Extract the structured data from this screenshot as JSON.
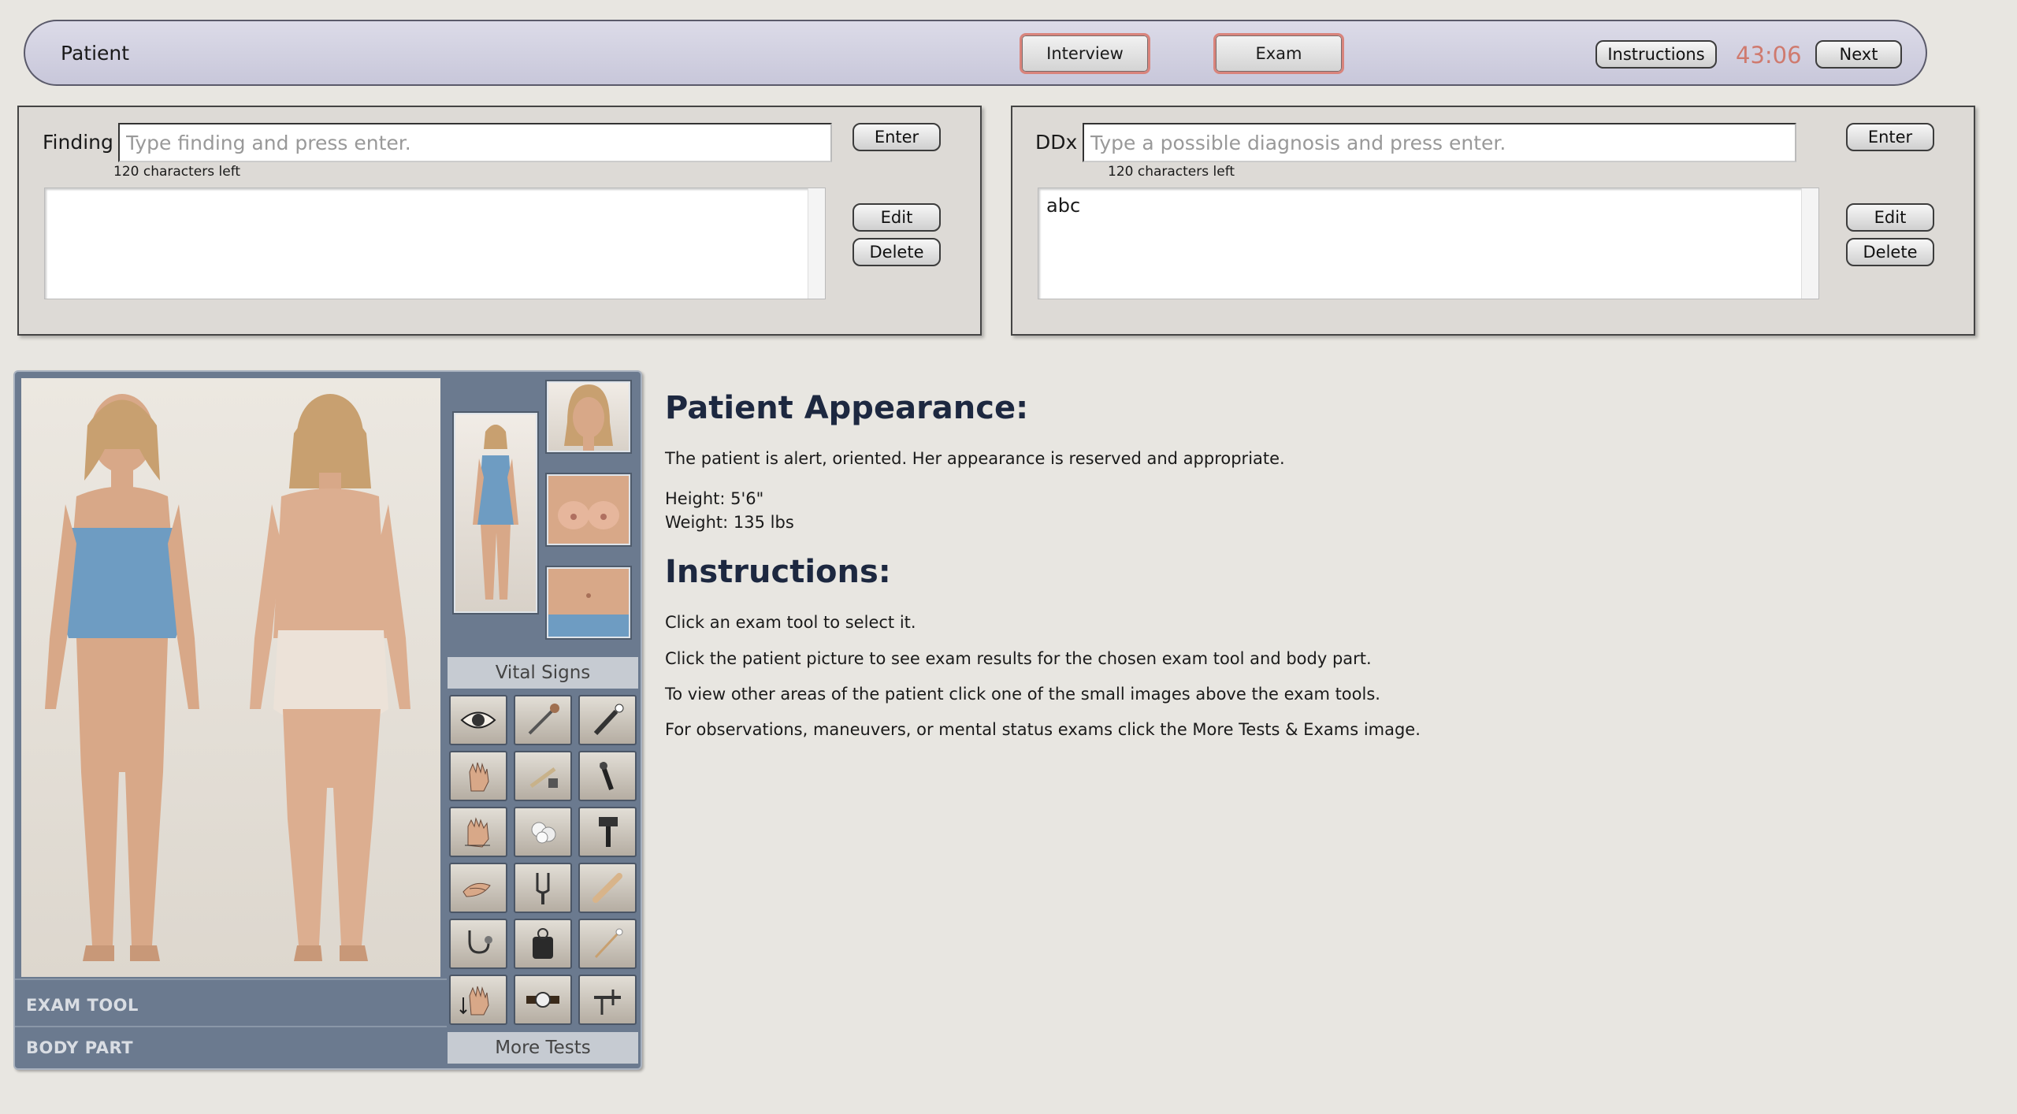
{
  "topbar": {
    "patient_label": "Patient",
    "interview_label": "Interview",
    "exam_label": "Exam",
    "instructions_label": "Instructions",
    "timer": "43:06",
    "next_label": "Next"
  },
  "finding": {
    "label": "Finding",
    "placeholder": "Type finding and press enter.",
    "chars_left": "120 characters left",
    "enter_label": "Enter",
    "edit_label": "Edit",
    "delete_label": "Delete",
    "entries": []
  },
  "ddx": {
    "label": "DDx",
    "placeholder": "Type a possible diagnosis and press enter.",
    "chars_left": "120 characters left",
    "enter_label": "Enter",
    "edit_label": "Edit",
    "delete_label": "Delete",
    "entries": [
      "abc"
    ]
  },
  "exam": {
    "exam_tool_label": "EXAM TOOL",
    "body_part_label": "BODY PART",
    "vital_signs_label": "Vital Signs",
    "more_tests_label": "More Tests",
    "tools": [
      "eye-icon",
      "reflex-hammer-icon",
      "penlight-icon",
      "palpate-hand-icon",
      "tape-measure-icon",
      "otoscope-icon",
      "percussion-hand-icon",
      "cotton-icon",
      "ophthalmoscope-icon",
      "pinch-icon",
      "tuning-fork-icon",
      "tongue-depressor-icon",
      "stethoscope-icon",
      "blood-pressure-cuff-icon",
      "swab-icon",
      "range-of-motion-icon",
      "watch-icon",
      "caliper-icon"
    ]
  },
  "info": {
    "appearance_heading": "Patient Appearance:",
    "appearance_text": "The patient is alert, oriented. Her appearance is reserved and appropriate.",
    "height": "Height: 5'6\"",
    "weight": "Weight: 135 lbs",
    "instructions_heading": "Instructions:",
    "line1": "Click an exam tool to select it.",
    "line2": "Click the patient picture to see exam results for the chosen exam tool and body part.",
    "line3": "To view other areas of the patient click one of the small images above the exam tools.",
    "line4": "For observations, maneuvers, or mental status exams click the More Tests & Exams image."
  },
  "colors": {
    "timer": "#cf7a6e",
    "panel_bg": "#6b7a8f",
    "tab_border": "#d9847c"
  }
}
